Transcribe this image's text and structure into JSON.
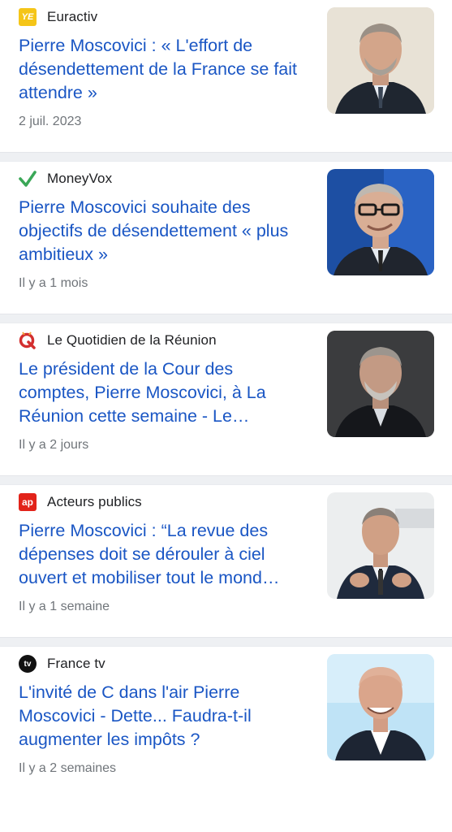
{
  "articles": [
    {
      "source": "Euractiv",
      "source_logo": "euractiv-logo",
      "headline": "Pierre Moscovici : « L'effort de désendettement de la France se fait attendre »",
      "time": "2 juil. 2023"
    },
    {
      "source": "MoneyVox",
      "source_logo": "moneyvox-checkmark-logo",
      "headline": "Pierre Moscovici souhaite des objectifs de désendettement « plus ambitieux »",
      "time": "Il y a 1 mois"
    },
    {
      "source": "Le Quotidien de la Réunion",
      "source_logo": "le-quotidien-logo",
      "headline": "Le président de la Cour des comptes, Pierre Moscovici, à La Réunion cette semaine - Le…",
      "time": "Il y a 2 jours"
    },
    {
      "source": "Acteurs publics",
      "source_logo": "acteurs-publics-logo",
      "headline": "Pierre Moscovici : “La revue des dépenses doit se dérouler à ciel ouvert et mobiliser tout le mond…",
      "time": "Il y a 1 semaine"
    },
    {
      "source": "France tv",
      "source_logo": "france-tv-logo",
      "headline": "L'invité de C dans l'air Pierre Moscovici - Dette... Faudra-t-il augmenter les impôts ?",
      "time": "Il y a 2 semaines"
    }
  ],
  "logos": {
    "euractiv_text": "YE",
    "acteurs_text": "ap",
    "francetv_text": "tv"
  },
  "colors": {
    "headline": "#1a56c4",
    "euractiv": "#f5c518",
    "moneyvox": "#3aa757",
    "quotidien": "#d32f2f",
    "acteurs": "#e2231a",
    "francetv": "#111111"
  }
}
